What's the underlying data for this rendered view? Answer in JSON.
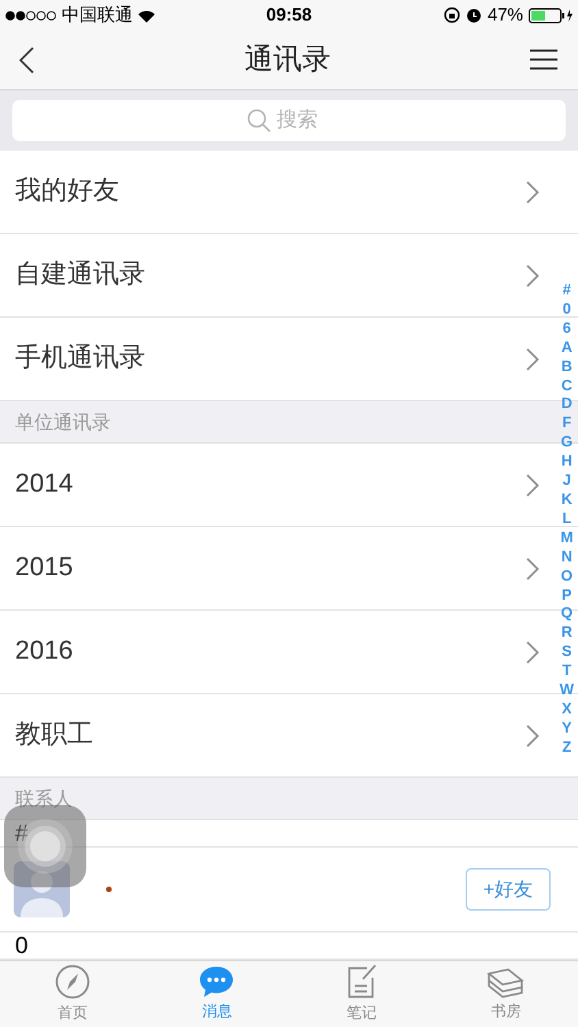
{
  "status_bar": {
    "carrier": "中国联通",
    "time": "09:58",
    "battery": "47%"
  },
  "nav_bar": {
    "title": "通讯录"
  },
  "search": {
    "placeholder": "搜索"
  },
  "sections": [
    {
      "items": [
        {
          "label": "我的好友"
        },
        {
          "label": "自建通讯录"
        },
        {
          "label": "手机通讯录"
        }
      ]
    },
    {
      "header": "单位通讯录",
      "items": [
        {
          "label": "2014"
        },
        {
          "label": "2015"
        },
        {
          "label": "2016"
        },
        {
          "label": "教职工"
        }
      ]
    }
  ],
  "contacts": {
    "header": "联系人",
    "groups": [
      {
        "letter": "#",
        "contacts": [
          {
            "add_button": "+好友"
          }
        ]
      },
      {
        "letter": "0"
      }
    ]
  },
  "index": [
    "#",
    "0",
    "6",
    "A",
    "B",
    "C",
    "D",
    "F",
    "G",
    "H",
    "J",
    "K",
    "L",
    "M",
    "N",
    "O",
    "P",
    "Q",
    "R",
    "S",
    "T",
    "W",
    "X",
    "Y",
    "Z"
  ],
  "tab_bar": [
    {
      "label": "首页",
      "kind": "compass",
      "selected": false
    },
    {
      "label": "消息",
      "kind": "chat",
      "selected": true
    },
    {
      "label": "笔记",
      "kind": "note",
      "selected": false
    },
    {
      "label": "书房",
      "kind": "books",
      "selected": false
    }
  ]
}
